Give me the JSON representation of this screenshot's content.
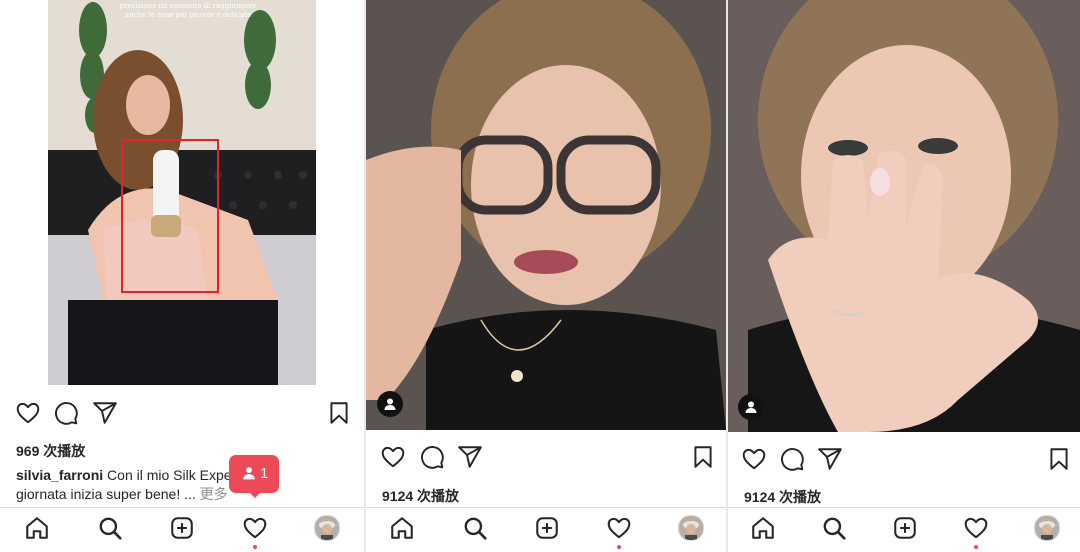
{
  "posts": [
    {
      "views": "969 次播放",
      "overlay_text": [
        "precisione mi consente di raggiungere",
        "anche le zone più piccole e delicate"
      ],
      "caption": {
        "username": "silvia_farroni",
        "text": " Con il mio Silk Expe... 5 la giornata inizia super bene! ... ",
        "more": "更多"
      },
      "notification": {
        "count": "1",
        "icon": "user-icon"
      }
    },
    {
      "views": "9124 次播放",
      "tag_icon": "user-icon"
    },
    {
      "views": "9124 次播放",
      "tag_icon": "user-icon"
    }
  ],
  "actions": [
    "heart-icon",
    "comment-icon",
    "send-icon",
    "bookmark-icon"
  ],
  "nav_items": [
    "home-icon",
    "search-icon",
    "add-icon",
    "activity-heart-icon",
    "profile-avatar"
  ],
  "colors": {
    "notification": "#ed4956",
    "text": "#262626",
    "secondary": "#8e8e8e",
    "highlight_box": "#e0242a"
  }
}
